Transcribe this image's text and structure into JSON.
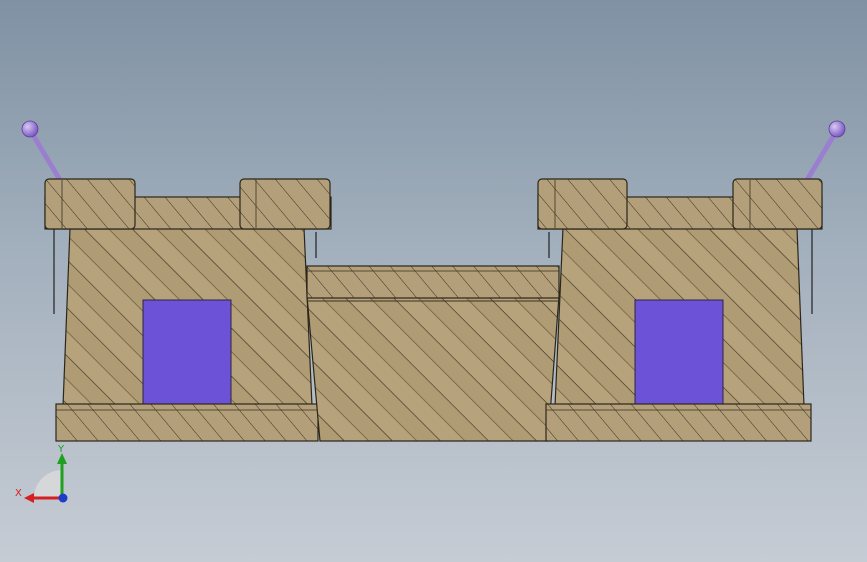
{
  "viewport": {
    "background_top": "#7f91a3",
    "background_bottom": "#c6ccd4"
  },
  "model": {
    "stone_color": "#b6a37c",
    "stone_dark": "#8d7c5a",
    "window_color": "#6c52d6",
    "antenna_color": "#9a7fd1"
  },
  "triad": {
    "x_label": "X",
    "y_label": "Y",
    "x_color": "#d42020",
    "y_color": "#20a020",
    "z_color": "#1f3cc8"
  }
}
